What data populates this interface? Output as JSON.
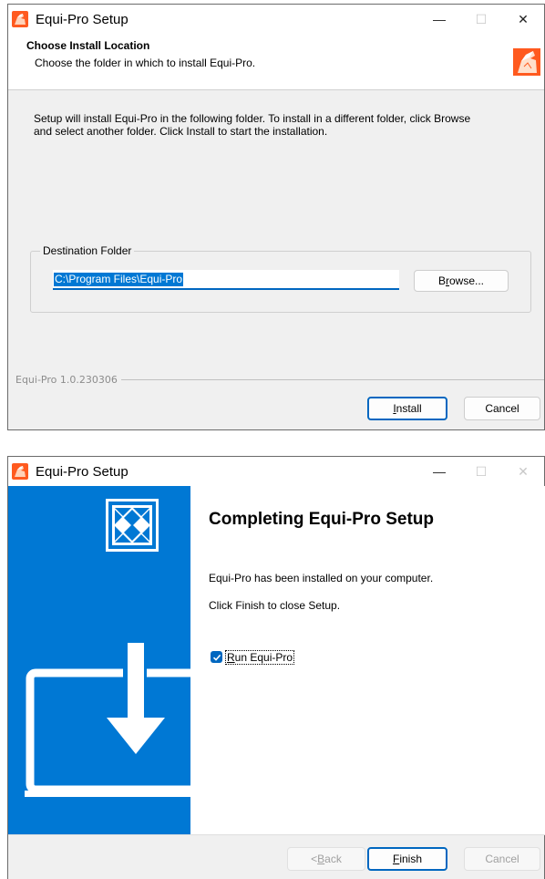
{
  "install_dialog": {
    "title": "Equi-Pro Setup",
    "header_title": "Choose Install Location",
    "header_subtitle": "Choose the folder in which to install Equi-Pro.",
    "body_text_line1": "Setup will install Equi-Pro in the following folder. To install in a different folder, click Browse",
    "body_text_line2": "and select another folder. Click Install to start the installation.",
    "destination_label": "Destination Folder",
    "destination_value": "C:\\Program Files\\Equi-Pro",
    "browse_prefix": "B",
    "browse_accel": "r",
    "browse_suffix": "owse...",
    "version": "Equi-Pro 1.0.230306",
    "install_accel": "I",
    "install_rest": "nstall",
    "cancel_label": "Cancel"
  },
  "finish_dialog": {
    "title": "Equi-Pro Setup",
    "heading": "Completing Equi-Pro Setup",
    "line1": "Equi-Pro has been installed on your computer.",
    "line2": "Click Finish to close Setup.",
    "run_checkbox_accel": "R",
    "run_checkbox_rest": "un Equi-Pro",
    "run_checked": true,
    "back_prefix": "< ",
    "back_accel": "B",
    "back_rest": "ack",
    "finish_accel": "F",
    "finish_rest": "inish",
    "cancel_label": "Cancel"
  },
  "window_controls": {
    "minimize": "—",
    "maximize": "☐",
    "close": "✕"
  },
  "colors": {
    "accent_blue": "#0078d4",
    "app_icon_orange": "#ff5a1f"
  }
}
